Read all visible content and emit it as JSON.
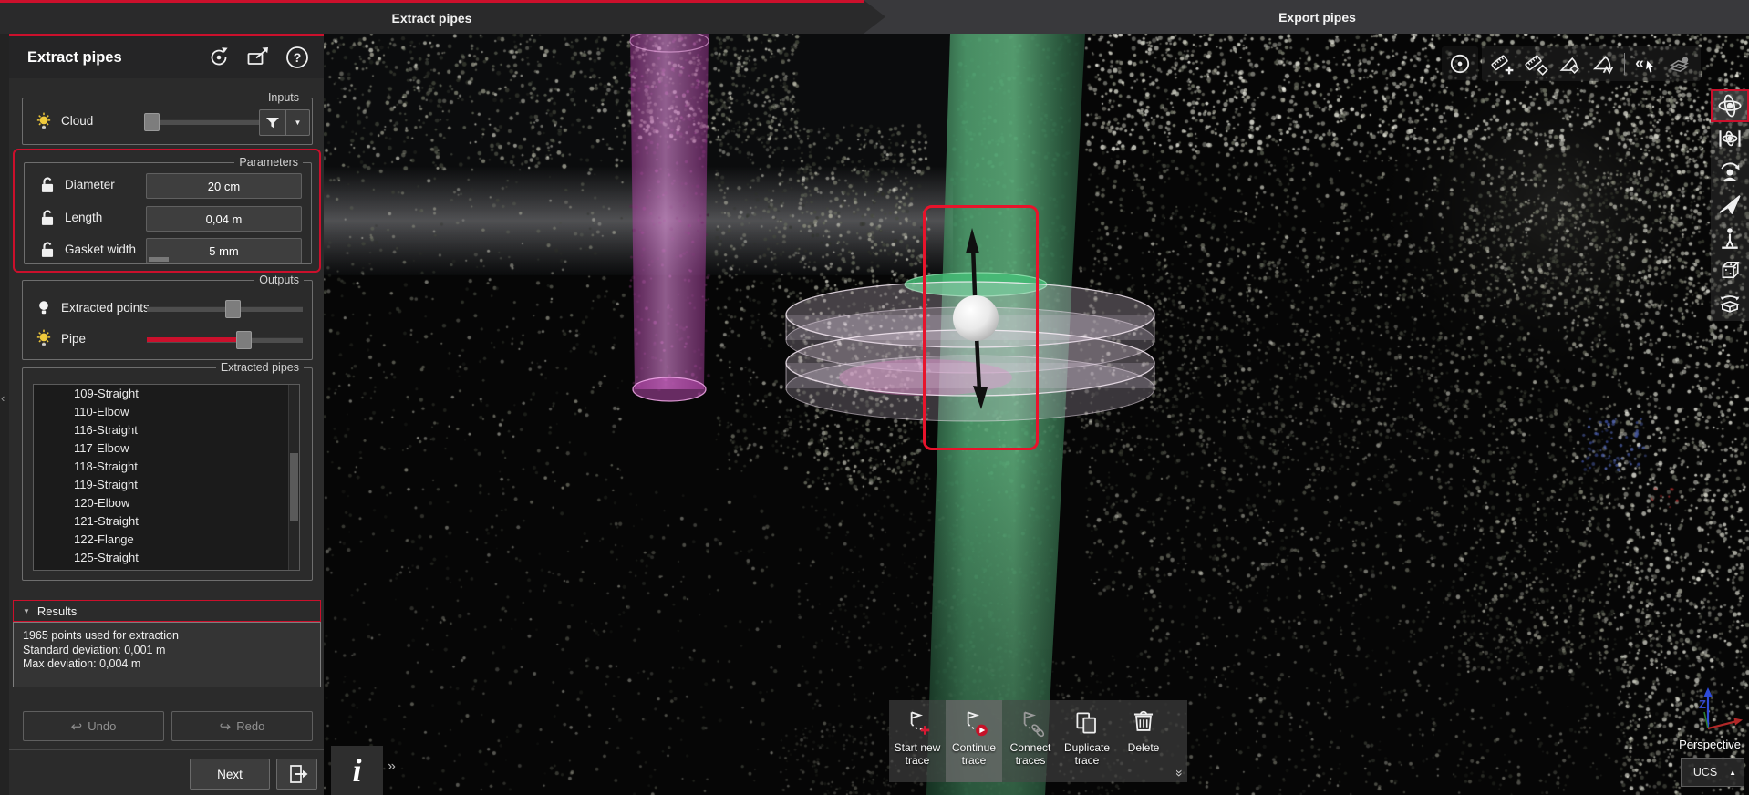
{
  "colors": {
    "accent": "#cb102c",
    "selection_red": "#e8132b",
    "pipe_green": "#58b57e",
    "pipe_magenta": "#d75ac8"
  },
  "tabs": {
    "extract": "Extract pipes",
    "export": "Export pipes"
  },
  "panel": {
    "title": "Extract pipes",
    "inputs": {
      "legend": "Inputs",
      "cloud": "Cloud",
      "cloud_pct": 4
    },
    "parameters": {
      "legend": "Parameters",
      "rows": [
        {
          "label": "Diameter",
          "value": "20 cm"
        },
        {
          "label": "Length",
          "value": "0,04 m"
        },
        {
          "label": "Gasket width",
          "value": "5 mm"
        }
      ]
    },
    "outputs": {
      "legend": "Outputs",
      "extracted_points": "Extracted points",
      "pipe": "Pipe",
      "extracted_points_pct": 55,
      "pipe_pct": 62
    },
    "extracted_pipes": {
      "legend": "Extracted pipes",
      "items": [
        "109-Straight",
        "110-Elbow",
        "116-Straight",
        "117-Elbow",
        "118-Straight",
        "119-Straight",
        "120-Elbow",
        "121-Straight",
        "122-Flange",
        "125-Straight"
      ]
    },
    "results": {
      "title": "Results",
      "lines": [
        "1965 points used for extraction",
        "Standard deviation: 0,001 m",
        "Max deviation: 0,004 m"
      ]
    },
    "undo": "Undo",
    "redo": "Redo",
    "next": "Next"
  },
  "viewport": {
    "trace_toolbar": {
      "start_new": "Start new trace",
      "continue": "Continue trace",
      "connect": "Connect traces",
      "duplicate": "Duplicate trace",
      "delete": "Delete"
    },
    "info": "i",
    "projection": "Perspective",
    "ucs": "UCS",
    "axis_z": "Z"
  },
  "icons": {
    "help": "?",
    "panel_collapse": "‹",
    "results_chevron": "▼",
    "dropdown_down": "▼",
    "dropdown_up": "▲",
    "undo_arrow": "↩",
    "redo_arrow": "↪",
    "more": "»",
    "guillemet": "«"
  }
}
